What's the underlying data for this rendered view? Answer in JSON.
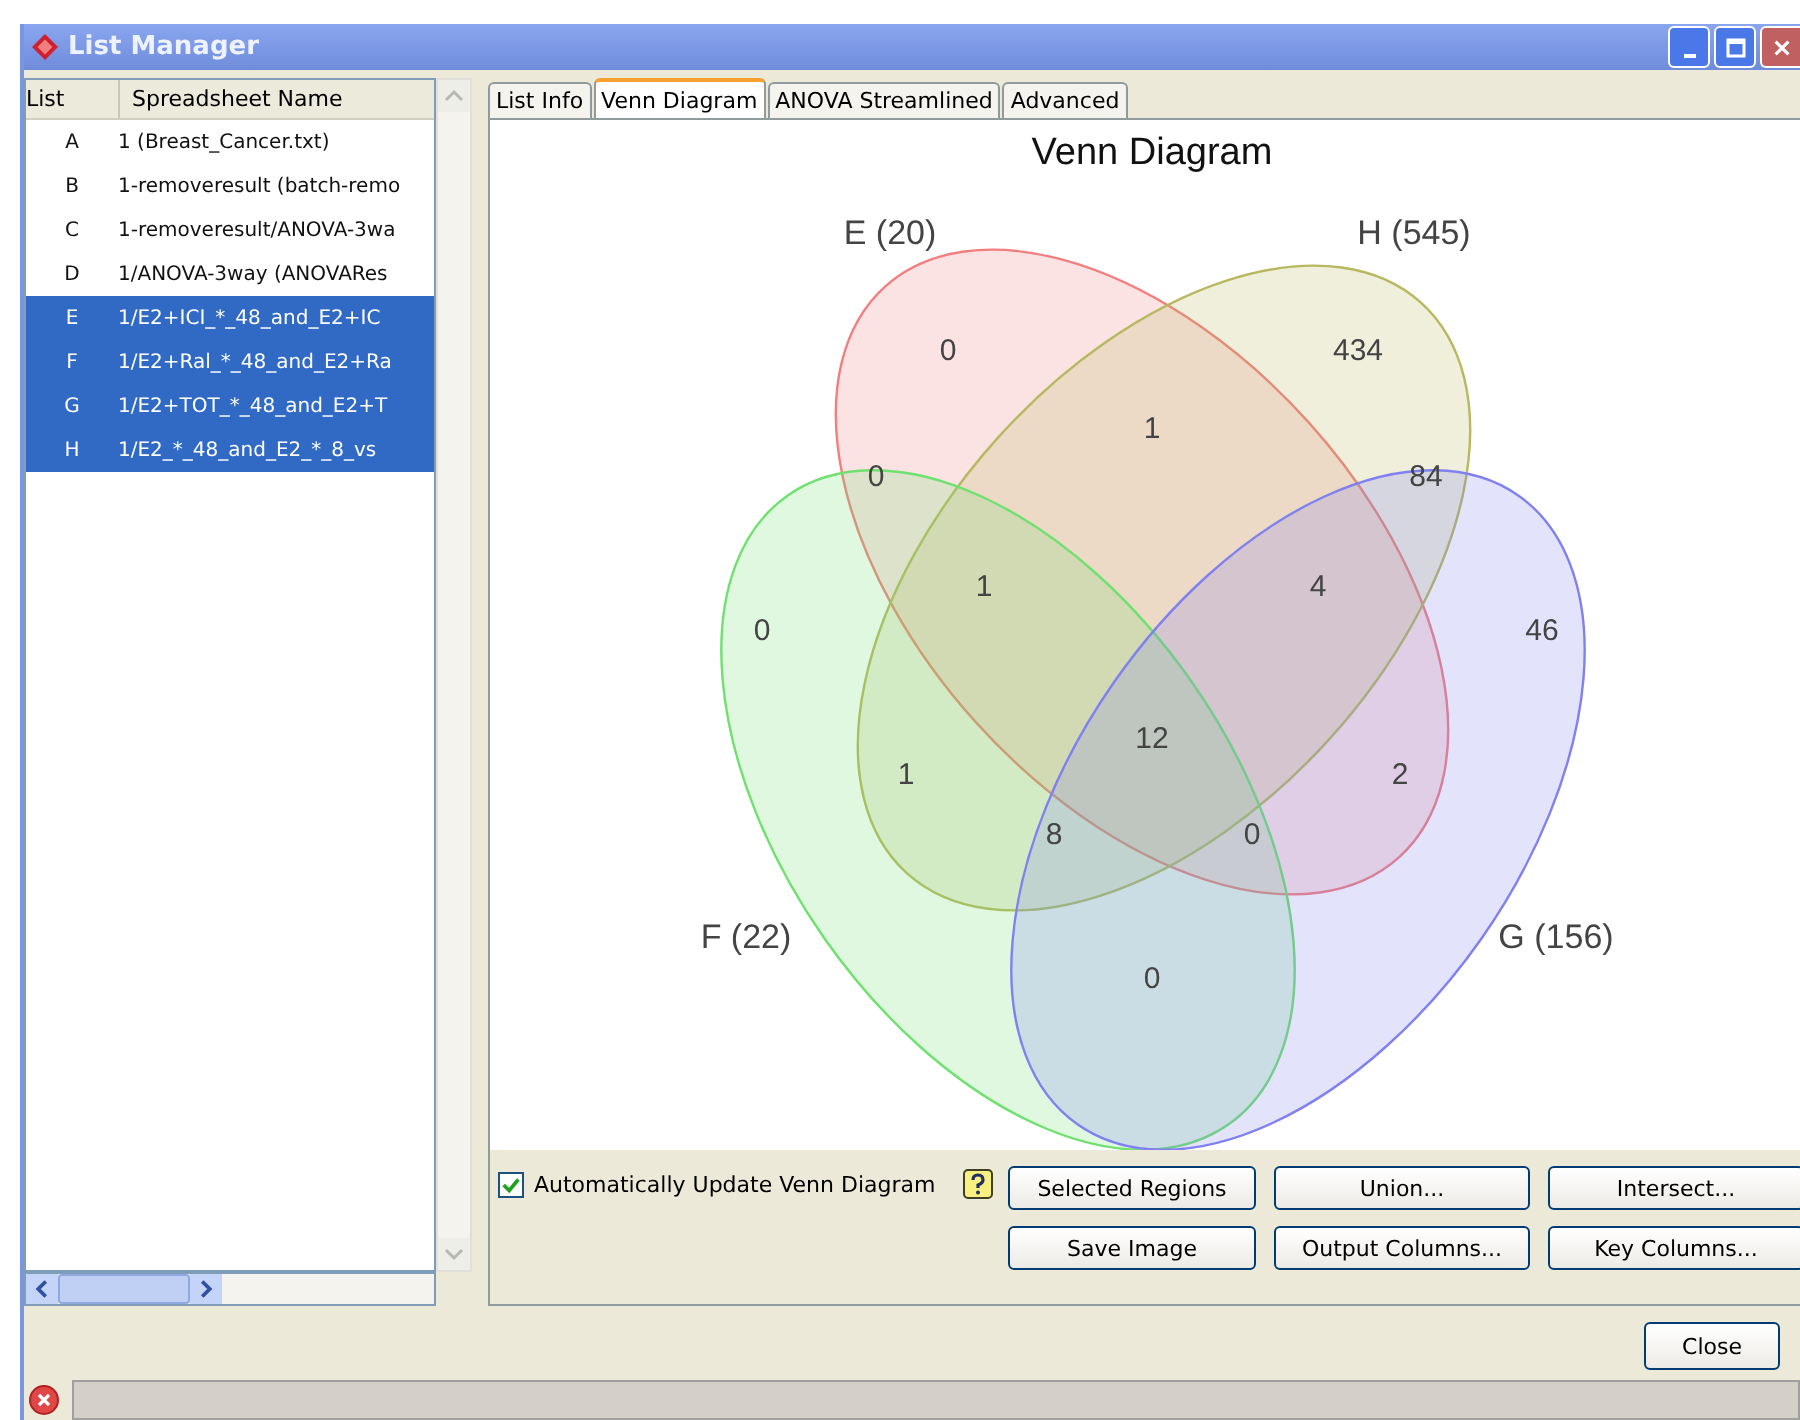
{
  "window": {
    "title": "List Manager"
  },
  "list": {
    "columns": [
      "List",
      "Spreadsheet Name"
    ],
    "rows": [
      {
        "list": "A",
        "name": "1 (Breast_Cancer.txt)",
        "selected": false
      },
      {
        "list": "B",
        "name": "1-removeresult (batch-remo",
        "selected": false
      },
      {
        "list": "C",
        "name": "1-removeresult/ANOVA-3wa",
        "selected": false
      },
      {
        "list": "D",
        "name": "1/ANOVA-3way (ANOVARes",
        "selected": false
      },
      {
        "list": "E",
        "name": "1/E2+ICI_*_48_and_E2+IC",
        "selected": true
      },
      {
        "list": "F",
        "name": "1/E2+Ral_*_48_and_E2+Ra",
        "selected": true
      },
      {
        "list": "G",
        "name": "1/E2+TOT_*_48_and_E2+T",
        "selected": true
      },
      {
        "list": "H",
        "name": "1/E2_*_48_and_E2_*_8_vs",
        "selected": true
      }
    ]
  },
  "tabs": [
    {
      "label": "List Info",
      "selected": false
    },
    {
      "label": "Venn Diagram",
      "selected": true
    },
    {
      "label": "ANOVA Streamlined",
      "selected": false
    },
    {
      "label": "Advanced",
      "selected": false
    }
  ],
  "venn": {
    "title": "Venn Diagram",
    "sets": [
      {
        "label": "E (20)",
        "color": "#f08080"
      },
      {
        "label": "H (545)",
        "color": "#b8b860"
      },
      {
        "label": "F (22)",
        "color": "#70e070"
      },
      {
        "label": "G (156)",
        "color": "#8080f0"
      }
    ],
    "regions": [
      "0",
      "434",
      "1",
      "84",
      "0",
      "1",
      "4",
      "0",
      "46",
      "12",
      "1",
      "2",
      "8",
      "0",
      "0"
    ]
  },
  "auto_update": {
    "label": "Automatically Update Venn Diagram",
    "checked": true
  },
  "buttons": [
    [
      "Selected Regions",
      "Union...",
      "Intersect..."
    ],
    [
      "Save Image",
      "Output Columns...",
      "Key Columns..."
    ]
  ],
  "close_button": "Close"
}
